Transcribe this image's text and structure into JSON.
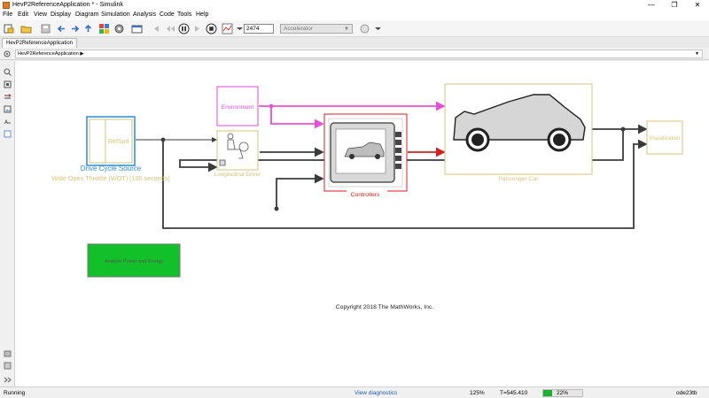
{
  "window": {
    "title": "HevP2ReferenceApplication * - Simulink",
    "controls": {
      "minimize": "—",
      "maximize": "❐",
      "close": "✕"
    }
  },
  "menu": [
    "File",
    "Edit",
    "View",
    "Display",
    "Diagram",
    "Simulation",
    "Analysis",
    "Code",
    "Tools",
    "Help"
  ],
  "toolbar": {
    "stop_time": "2474",
    "sim_mode": "Accelerator"
  },
  "tabs": [
    "HevP2ReferenceApplication"
  ],
  "breadcrumb": "HevP2ReferenceApplication",
  "diagram": {
    "blocks": {
      "drive_cycle": {
        "port": "RefSpd",
        "name": "Drive Cycle Source",
        "subtitle": "Wide Open Throttle (WOT) (100  seconds)"
      },
      "environment": {
        "name": "Environment"
      },
      "driver": {
        "name": "Longitudinal Driver"
      },
      "controllers": {
        "name": "Controllers"
      },
      "passenger_car": {
        "name": "Passenger Car"
      },
      "visualization": {
        "name": "Visualization"
      },
      "analyze": {
        "name": "Analyze Power and Energy"
      }
    },
    "copyright": "Copyright 2018 The MathWorks, Inc.",
    "colors": {
      "drive_cycle": "#2a8fd6",
      "environment": "#e14bd6",
      "signal_magenta": "#e650d8",
      "controllers": "#d51e1e",
      "block_gold": "#d6c47a",
      "analyze_fill": "#12c12a",
      "line": "#3b3b3b"
    }
  },
  "status": {
    "state": "Running",
    "diagnostics": "View diagnostics",
    "zoom": "125%",
    "time": "T=545.410",
    "progress_percent": 22,
    "progress_label": "22%",
    "solver": "ode23tb"
  }
}
